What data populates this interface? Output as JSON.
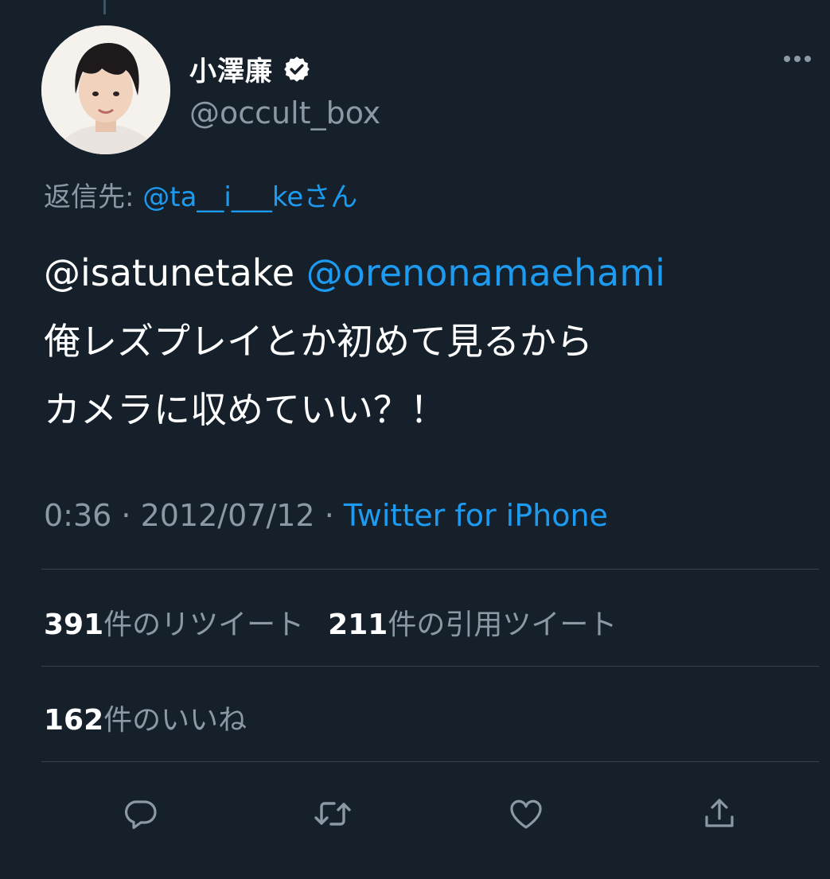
{
  "thread_connector": true,
  "author": {
    "display_name": "小澤廉",
    "handle": "@occult_box",
    "verified": true,
    "avatar": "profile-photo"
  },
  "reply_to": {
    "prefix": "返信先: ",
    "user": "@ta__i___ke",
    "suffix": "さん"
  },
  "tweet": {
    "mention1": "@isatunetake",
    "mention2": "@orenonamaehami",
    "line2": "俺レズプレイとか初めて見るから",
    "line3": "カメラに収めていい？！"
  },
  "meta": {
    "time": "0:36",
    "sep1": " · ",
    "date": "2012/07/12",
    "sep2": " · ",
    "source": "Twitter for iPhone"
  },
  "stats": {
    "retweets_count": "391",
    "retweets_label": "件のリツイート",
    "quotes_count": "211",
    "quotes_label": "件の引用ツイート",
    "likes_count": "162",
    "likes_label": "件のいいね"
  },
  "actions": [
    {
      "icon": "reply-icon"
    },
    {
      "icon": "retweet-icon"
    },
    {
      "icon": "like-icon"
    },
    {
      "icon": "share-icon"
    }
  ],
  "colors": {
    "background": "#15202b",
    "link": "#1d9bf0",
    "secondary_text": "#8b98a5",
    "divider": "#38444d"
  }
}
